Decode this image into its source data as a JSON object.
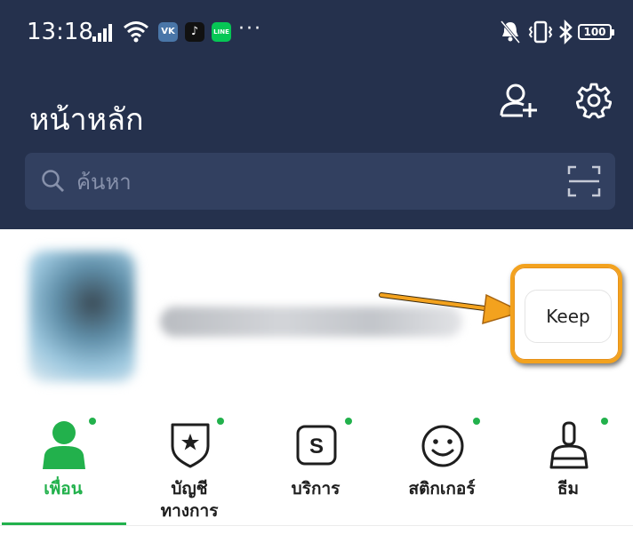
{
  "status_bar": {
    "time": "13:18",
    "app_vk": "VK",
    "app_tiktok": "♪",
    "app_line": "LINE",
    "more": "···",
    "battery": "100"
  },
  "header": {
    "title": "หน้าหลัก",
    "add_friend_icon": "add-friend-icon",
    "settings_icon": "gear-icon"
  },
  "search": {
    "placeholder": "ค้นหา"
  },
  "profile": {
    "keep_label": "Keep"
  },
  "tabs": [
    {
      "label": "เพื่อน",
      "active": true,
      "icon": "person-icon"
    },
    {
      "label": "บัญชี\nทางการ",
      "active": false,
      "icon": "official-account-icon"
    },
    {
      "label": "บริการ",
      "active": false,
      "icon": "services-icon"
    },
    {
      "label": "สติกเกอร์",
      "active": false,
      "icon": "sticker-icon"
    },
    {
      "label": "ธีม",
      "active": false,
      "icon": "theme-brush-icon"
    }
  ],
  "colors": {
    "header_bg": "#25314d",
    "search_bg": "#324060",
    "accent_green": "#22b14c",
    "highlight_orange": "#f3a21e"
  }
}
